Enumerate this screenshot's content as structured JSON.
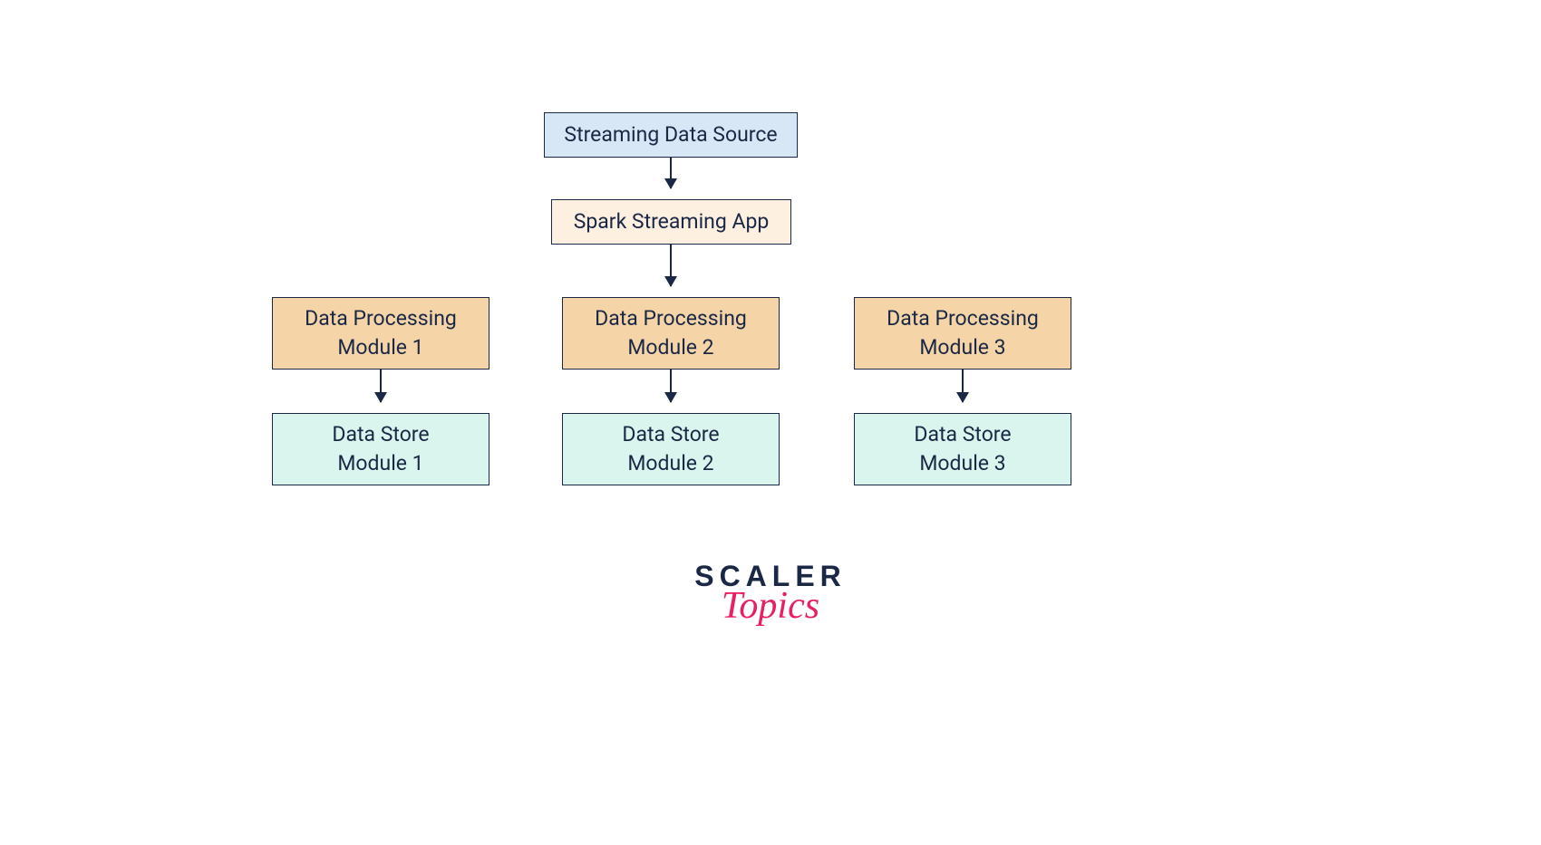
{
  "nodes": {
    "source": "Streaming Data Source",
    "app": "Spark Streaming App",
    "processing1": "Data Processing\nModule 1",
    "processing2": "Data Processing\nModule 2",
    "processing3": "Data Processing\nModule 3",
    "store1": "Data Store\nModule 1",
    "store2": "Data Store\nModule 2",
    "store3": "Data Store\nModule 3"
  },
  "logo": {
    "line1": "SCALER",
    "line2": "Topics"
  },
  "colors": {
    "blue": "#d7e7f5",
    "cream": "#fdf0e0",
    "orange": "#f5d5a8",
    "mint": "#daf5ed",
    "border": "#1a2845",
    "pink": "#e91e63"
  }
}
